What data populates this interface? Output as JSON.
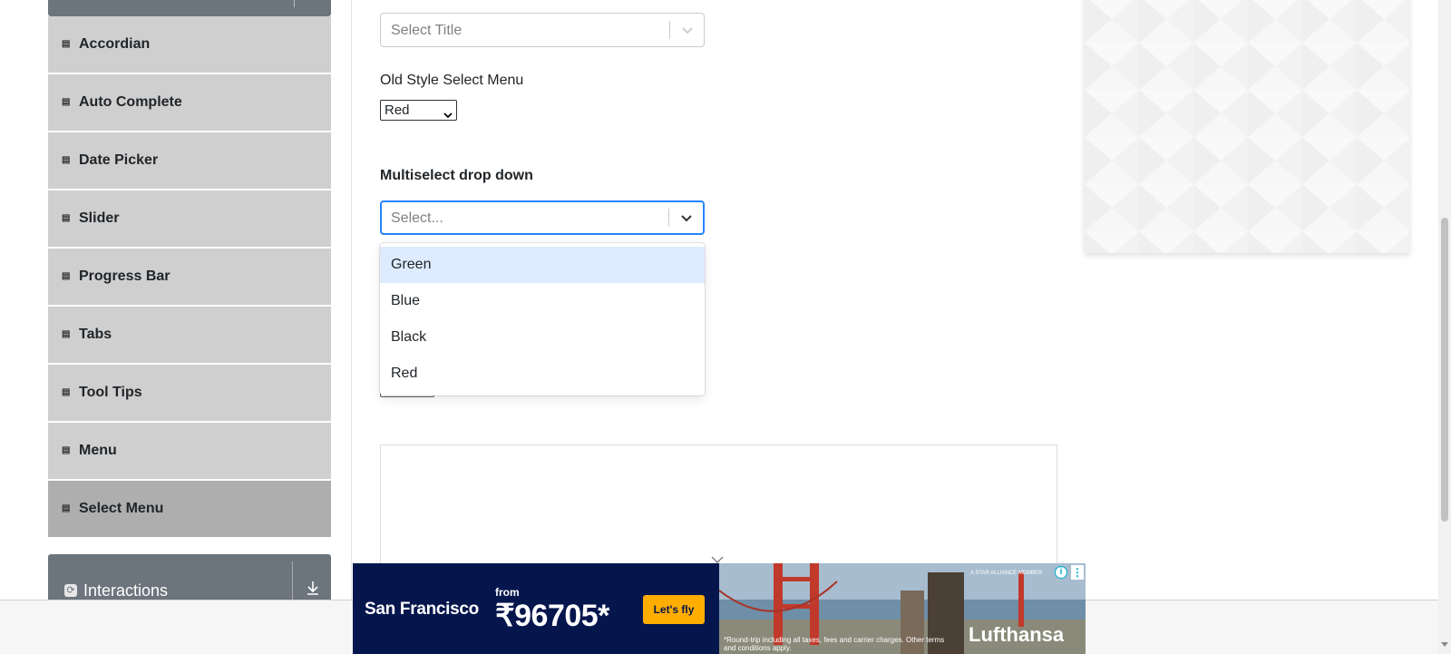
{
  "sidebar": {
    "items": [
      {
        "label": "Accordian"
      },
      {
        "label": "Auto Complete"
      },
      {
        "label": "Date Picker"
      },
      {
        "label": "Slider"
      },
      {
        "label": "Progress Bar"
      },
      {
        "label": "Tabs"
      },
      {
        "label": "Tool Tips"
      },
      {
        "label": "Menu"
      },
      {
        "label": "Select Menu",
        "active": true
      }
    ],
    "next_group": {
      "label": "Interactions",
      "icon": "refresh-icon"
    }
  },
  "form": {
    "select_title": {
      "placeholder": "Select Title"
    },
    "old_style": {
      "label": "Old Style Select Menu",
      "value": "Red"
    },
    "multiselect": {
      "label": "Multiselect drop down",
      "placeholder": "Select...",
      "options": [
        "Green",
        "Blue",
        "Black",
        "Red"
      ],
      "highlighted": "Green"
    }
  },
  "ad": {
    "city": "San Francisco",
    "from": "from",
    "price": "₹96705*",
    "cta": "Let's fly",
    "brand": "Lufthansa",
    "alliance": "A STAR ALLIANCE MEMBER",
    "fine_print": "*Round-trip including all taxes, fees and carrier charges. Other terms and conditions apply.",
    "colors": {
      "navy": "#05164d",
      "cta": "#ffad00"
    }
  },
  "colors": {
    "focus": "#2684ff",
    "option_highlight": "#deebff",
    "menu_item": "#cfcfcf",
    "menu_item_active": "#aeaeae",
    "group_header": "#6c757d"
  }
}
